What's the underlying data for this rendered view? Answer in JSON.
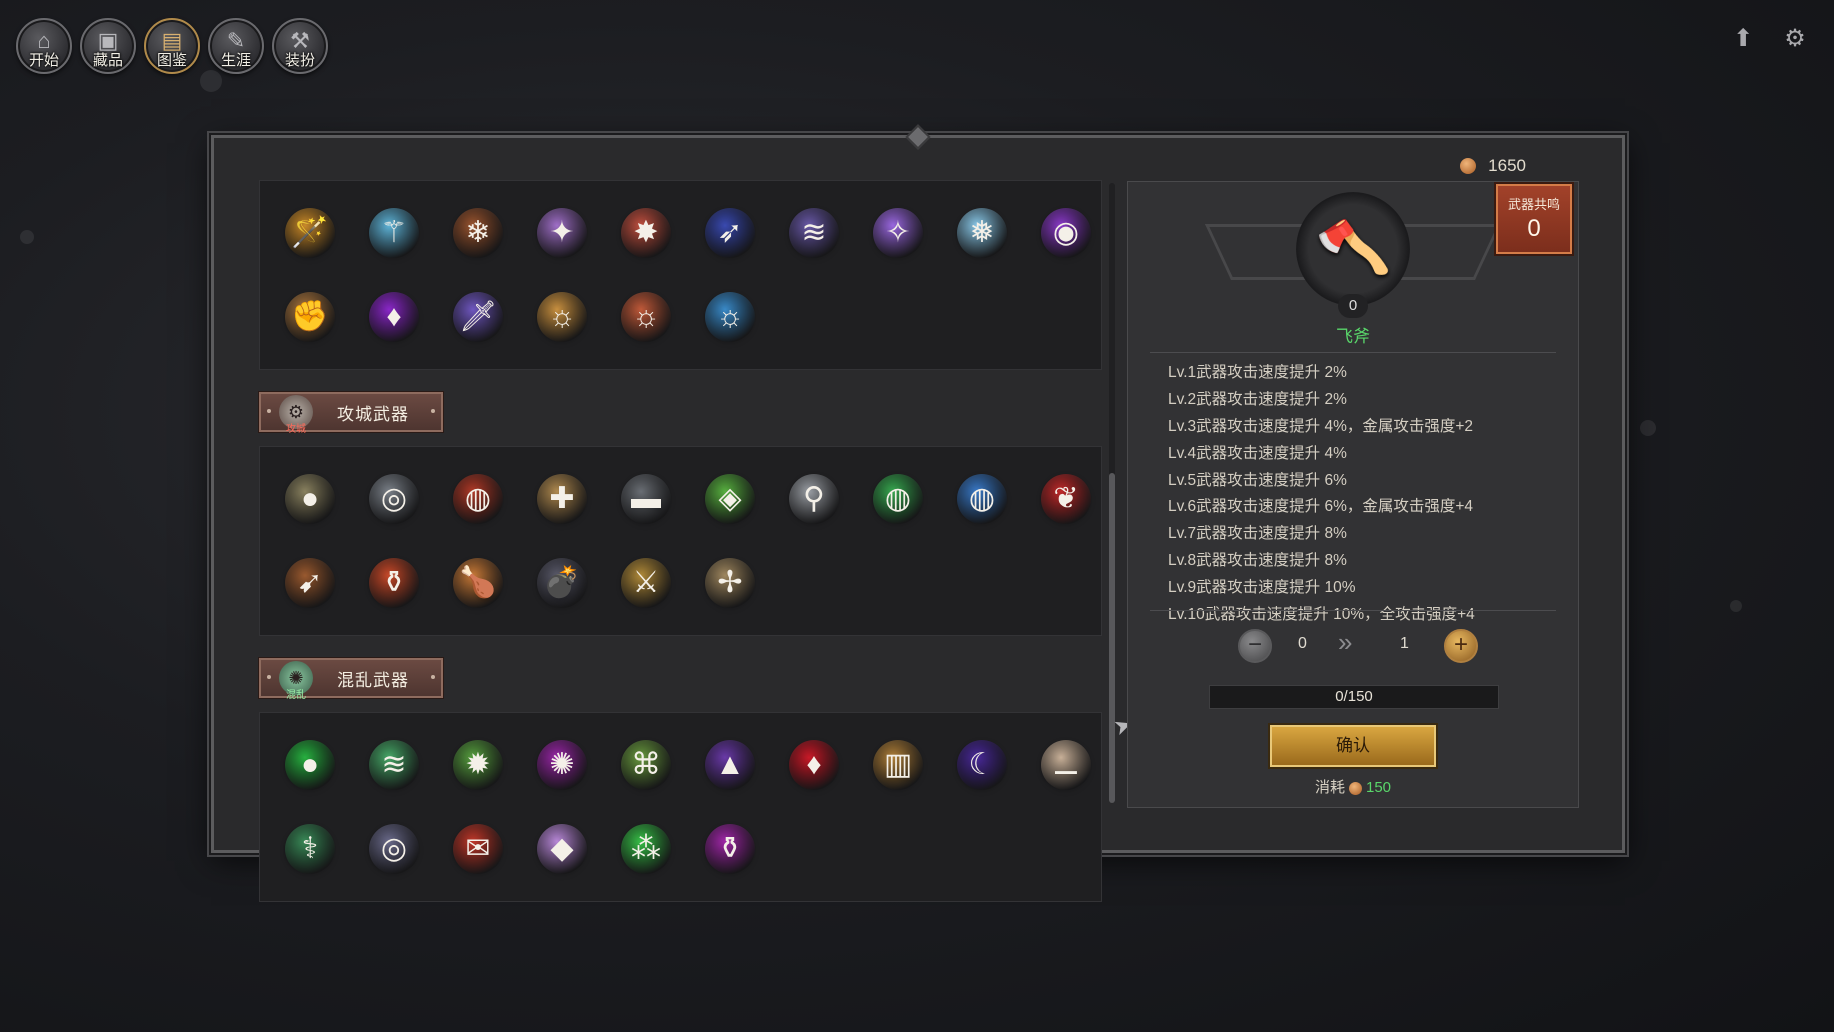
{
  "nav": [
    {
      "label": "开始",
      "icon": "home-icon",
      "glyph": "⌂"
    },
    {
      "label": "藏品",
      "icon": "cube-icon",
      "glyph": "▣"
    },
    {
      "label": "图鉴",
      "icon": "codex-icon",
      "glyph": "▤"
    },
    {
      "label": "生涯",
      "icon": "career-icon",
      "glyph": "✎"
    },
    {
      "label": "装扮",
      "icon": "hammer-icon",
      "glyph": "⚒"
    }
  ],
  "topright": {
    "upload_icon": "upload-icon",
    "upload_glyph": "⬆",
    "settings_icon": "gear-icon",
    "settings_glyph": "⚙"
  },
  "currency": {
    "amount": "1650",
    "icon": "coin-icon"
  },
  "sections": [
    {
      "title": "",
      "items": [
        {
          "name": "golden-wand-icon",
          "glyph": "🪄",
          "bg": "#c98a2a"
        },
        {
          "name": "crystal-staff-icon",
          "glyph": "⚚",
          "bg": "#5fb4d8"
        },
        {
          "name": "ice-gauntlet-icon",
          "glyph": "❄",
          "bg": "#9a5530"
        },
        {
          "name": "arcane-staff-icon",
          "glyph": "✦",
          "bg": "#a070c8"
        },
        {
          "name": "spiked-star-icon",
          "glyph": "✸",
          "bg": "#c05040"
        },
        {
          "name": "blue-bow-icon",
          "glyph": "➶",
          "bg": "#3a4ab0"
        },
        {
          "name": "shadow-claw-icon",
          "glyph": "≋",
          "bg": "#6a5aa8"
        },
        {
          "name": "void-shard-icon",
          "glyph": "✧",
          "bg": "#9a68e0"
        },
        {
          "name": "frost-flake-icon",
          "glyph": "❅",
          "bg": "#8ac8e8"
        },
        {
          "name": "purple-orb-icon",
          "glyph": "◉",
          "bg": "#8a3ac8"
        },
        {
          "name": "frost-gauntlet-icon",
          "glyph": "✊",
          "bg": "#b07a40"
        },
        {
          "name": "amethyst-flame-icon",
          "glyph": "♦",
          "bg": "#8a28c8"
        },
        {
          "name": "violet-blade-icon",
          "glyph": "🗡",
          "bg": "#7058c0"
        },
        {
          "name": "golden-rune-orb-icon",
          "glyph": "☼",
          "bg": "#c89040"
        },
        {
          "name": "crimson-rune-orb-icon",
          "glyph": "☼",
          "bg": "#c05a3a"
        },
        {
          "name": "azure-rune-orb-icon",
          "glyph": "☼",
          "bg": "#3a8ac8"
        }
      ]
    },
    {
      "title": "攻城武器",
      "emblem": "攻城",
      "emblem_icon": "siege-emblem-icon",
      "items": [
        {
          "name": "boulder-icon",
          "glyph": "●",
          "bg": "#8a8260"
        },
        {
          "name": "cannon-barrel-icon",
          "glyph": "◎",
          "bg": "#7a8088"
        },
        {
          "name": "fire-swirl-icon",
          "glyph": "◍",
          "bg": "#b03a28"
        },
        {
          "name": "bone-pile-icon",
          "glyph": "✚",
          "bg": "#b08a50"
        },
        {
          "name": "cannon-icon",
          "glyph": "▬",
          "bg": "#6a6e74"
        },
        {
          "name": "poison-barrel-icon",
          "glyph": "◈",
          "bg": "#58b040"
        },
        {
          "name": "wrecking-ball-icon",
          "glyph": "⚲",
          "bg": "#9a9ea4"
        },
        {
          "name": "green-vortex-icon",
          "glyph": "◍",
          "bg": "#38a850"
        },
        {
          "name": "blue-vortex-icon",
          "glyph": "◍",
          "bg": "#3a7ac8"
        },
        {
          "name": "crimson-wings-icon",
          "glyph": "❦",
          "bg": "#c02a2a"
        },
        {
          "name": "fire-rocket-icon",
          "glyph": "➹",
          "bg": "#9a5a30"
        },
        {
          "name": "red-potion-icon",
          "glyph": "⚱",
          "bg": "#c84a2a"
        },
        {
          "name": "meat-leg-icon",
          "glyph": "🍗",
          "bg": "#c87a38"
        },
        {
          "name": "black-bomb-icon",
          "glyph": "💣",
          "bg": "#5a5a6a"
        },
        {
          "name": "golden-trap-icon",
          "glyph": "⚔",
          "bg": "#b08a3a"
        },
        {
          "name": "ballista-icon",
          "glyph": "✢",
          "bg": "#a08860"
        }
      ]
    },
    {
      "title": "混乱武器",
      "emblem": "混乱",
      "emblem_icon": "chaos-emblem-icon",
      "items": [
        {
          "name": "green-orb-icon",
          "glyph": "●",
          "bg": "#28b040"
        },
        {
          "name": "green-claw-icon",
          "glyph": "≋",
          "bg": "#48a868"
        },
        {
          "name": "thorn-star-icon",
          "glyph": "✹",
          "bg": "#58a040"
        },
        {
          "name": "purple-gear-icon",
          "glyph": "✺",
          "bg": "#9a28a8"
        },
        {
          "name": "green-net-icon",
          "glyph": "⌘",
          "bg": "#6a9a40"
        },
        {
          "name": "witch-hat-icon",
          "glyph": "▲",
          "bg": "#6a3aa8"
        },
        {
          "name": "blood-crystal-icon",
          "glyph": "♦",
          "bg": "#c81a28"
        },
        {
          "name": "spell-book-icon",
          "glyph": "▥",
          "bg": "#b0803a"
        },
        {
          "name": "dark-scythe-icon",
          "glyph": "☾",
          "bg": "#4a2a9a"
        },
        {
          "name": "bone-club-icon",
          "glyph": "⚊",
          "bg": "#c8b098"
        },
        {
          "name": "poison-scythe-icon",
          "glyph": "⚕",
          "bg": "#3a8a58"
        },
        {
          "name": "void-portal-icon",
          "glyph": "◎",
          "bg": "#6a6a8a"
        },
        {
          "name": "red-scroll-icon",
          "glyph": "✉",
          "bg": "#c0382a"
        },
        {
          "name": "amethyst-gem-icon",
          "glyph": "◆",
          "bg": "#b888d8"
        },
        {
          "name": "green-cluster-icon",
          "glyph": "⁂",
          "bg": "#38c048"
        },
        {
          "name": "magenta-jar-icon",
          "glyph": "⚱",
          "bg": "#a028a8"
        }
      ]
    }
  ],
  "detail": {
    "weapon_name": "飞斧",
    "weapon_icon": "throwing-axe-icon",
    "weapon_glyph": "🪓",
    "weapon_level": "0",
    "resonance_label": "武器共鸣",
    "resonance_value": "0",
    "levels": [
      "Lv.1武器攻击速度提升 2%",
      "Lv.2武器攻击速度提升 2%",
      "Lv.3武器攻击速度提升 4%，金属攻击强度+2",
      "Lv.4武器攻击速度提升 4%",
      "Lv.5武器攻击速度提升 6%",
      "Lv.6武器攻击速度提升 6%，金属攻击强度+4",
      "Lv.7武器攻击速度提升 8%",
      "Lv.8武器攻击速度提升 8%",
      "Lv.9武器攻击速度提升 10%",
      "Lv.10武器攻击速度提升 10%，全攻击强度+4"
    ],
    "from_level": "0",
    "to_level": "1",
    "minus_glyph": "−",
    "plus_glyph": "+",
    "arrow_glyph": "»",
    "progress_text": "0/150",
    "progress_fraction": 0,
    "confirm_label": "确认",
    "cost_label": "消耗",
    "cost_value": "150"
  },
  "colors": {
    "accent_green": "#59d66a",
    "gold": "#d9a640",
    "resonance": "#a2422a"
  }
}
